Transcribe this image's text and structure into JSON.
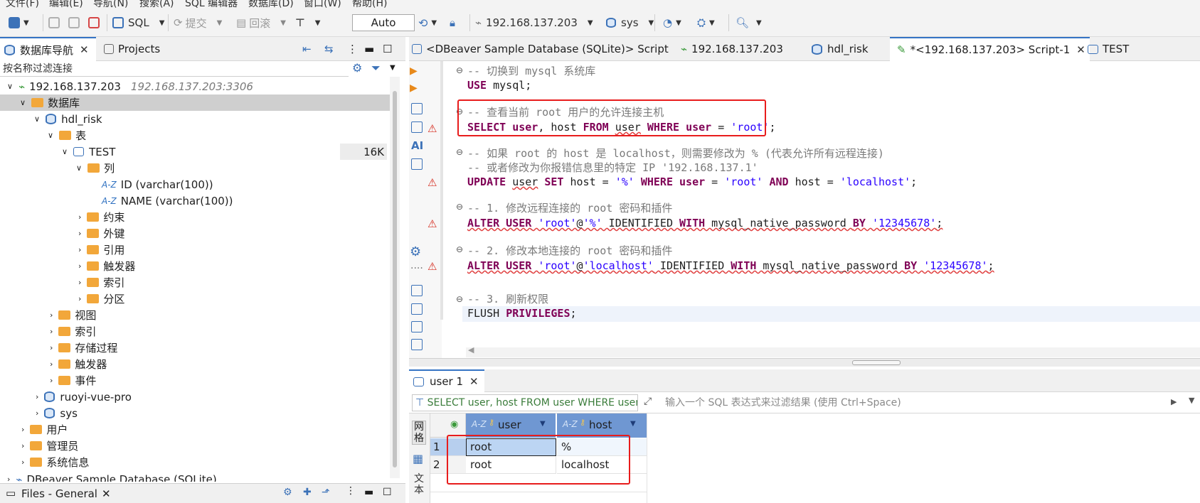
{
  "menu": [
    "文件(F)",
    "编辑(E)",
    "导航(N)",
    "搜索(A)",
    "SQL 编辑器",
    "数据库(D)",
    "窗口(W)",
    "帮助(H)"
  ],
  "toolbar": {
    "sql_label": "SQL",
    "commit_label": "提交",
    "rollback_label": "回滚",
    "auto_label": "Auto",
    "connection_label": "192.168.137.203",
    "schema_label": "sys"
  },
  "left_tabs": {
    "nav_label": "数据库导航",
    "projects_label": "Projects"
  },
  "filter": {
    "placeholder": "按名称过滤连接"
  },
  "tree": {
    "connection": {
      "name": "192.168.137.203",
      "address": "192.168.137.203:3306"
    },
    "databases": "数据库",
    "hdl_risk": "hdl_risk",
    "tables": "表",
    "test_table": "TEST",
    "test_size": "16K",
    "columns": "列",
    "col_id": "ID (varchar(100))",
    "col_name": "NAME (varchar(100))",
    "constraints": "约束",
    "foreign_keys": "外键",
    "references": "引用",
    "triggers": "触发器",
    "indexes": "索引",
    "partitions": "分区",
    "views": "视图",
    "db_indexes": "索引",
    "procedures": "存储过程",
    "db_triggers": "触发器",
    "events": "事件",
    "ruoyi": "ruoyi-vue-pro",
    "sys": "sys",
    "users": "用户",
    "admins": "管理员",
    "sysinfo": "系统信息",
    "sample_db": "DBeaver Sample Database (SQLite)"
  },
  "files_panel": {
    "title": "Files - General"
  },
  "editor_tabs": [
    {
      "label": "<DBeaver Sample Database (SQLite)> Script"
    },
    {
      "label": "192.168.137.203"
    },
    {
      "label": "hdl_risk"
    },
    {
      "label": "*<192.168.137.203> Script-1"
    },
    {
      "label": "TEST"
    }
  ],
  "sql": {
    "c1": "-- 切换到 mysql 系统库",
    "c2": "-- 查看当前 root 用户的允许连接主机",
    "c3": "-- 如果 root 的 host 是 localhost，则需要修改为 % (代表允许所有远程连接)",
    "c4": "-- 或者修改为你报错信息里的特定 IP '192.168.137.1'",
    "c5": "-- 1. 修改远程连接的 root 密码和插件",
    "c6": "-- 2. 修改本地连接的 root 密码和插件",
    "c7": "-- 3. 刷新权限",
    "use_kw": "USE",
    "use_db": " mysql;",
    "sel_1": "SELECT",
    "sel_2": " user",
    "sel_3": ", host ",
    "sel_4": "FROM",
    "sel_5": "user",
    "sel_6": "WHERE",
    "sel_7": "user",
    "sel_8": "'root'",
    "upd_1": "UPDATE",
    "upd_2": "user",
    "upd_3": "SET",
    "upd_4": " host = ",
    "upd_5": "'%'",
    "upd_6": "WHERE",
    "upd_7": "user",
    "upd_8": "'root'",
    "upd_9": "AND",
    "upd_10": " host = ",
    "upd_11": "'localhost'",
    "alt1_1": "ALTER USER",
    "alt1_2": "'root'",
    "alt1_3": "@",
    "alt1_4": "'%'",
    "alt1_5": " IDENTIFIED ",
    "alt1_6": "WITH",
    "alt1_7": " mysql_native_password ",
    "alt1_8": "BY",
    "alt1_9": "'12345678'",
    "alt2_4": "'localhost'",
    "flush_1": "FLUSH ",
    "flush_2": "PRIVILEGES",
    "semi": ";"
  },
  "results": {
    "tab_label": "user 1",
    "query_text": "SELECT user, host FROM user WHERE user =",
    "filter_placeholder": "输入一个 SQL 表达式来过滤结果 (使用 Ctrl+Space)",
    "columns": [
      "user",
      "host"
    ],
    "rows": [
      {
        "num": "1",
        "user": "root",
        "host": "%"
      },
      {
        "num": "2",
        "user": "root",
        "host": "localhost"
      }
    ],
    "side_label": "网格",
    "side_label2": "文本"
  },
  "colors": {
    "accent": "#3574c4",
    "highlight": "#e81c1c",
    "keyword": "#7f0055",
    "string": "#2a00ff"
  }
}
